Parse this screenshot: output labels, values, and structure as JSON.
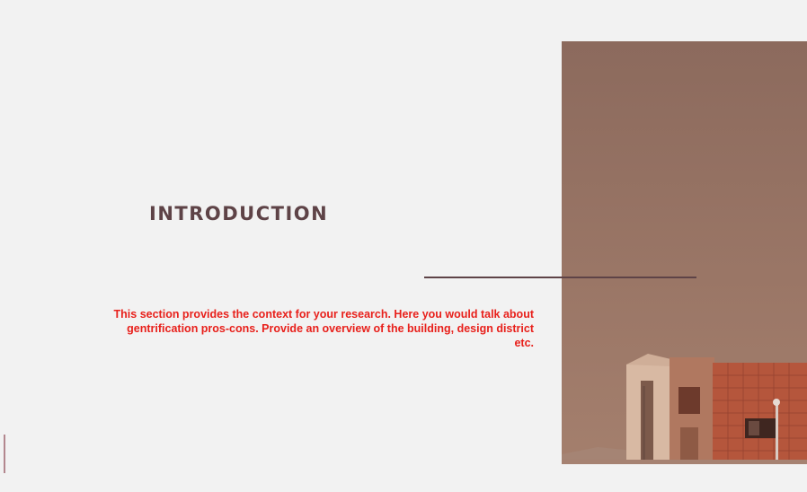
{
  "slide": {
    "title": "INTRODUCTION",
    "body": "This section provides the context for your research.  Here you would talk about gentrification pros-cons. Provide an overview of the building, design district etc."
  },
  "image": {
    "subject": "building-photo"
  },
  "colors": {
    "background": "#f2f2f2",
    "title": "#5e4347",
    "divider": "#5e4347",
    "body_text": "#e8201b",
    "photo_tint": "#8c6a5d"
  }
}
